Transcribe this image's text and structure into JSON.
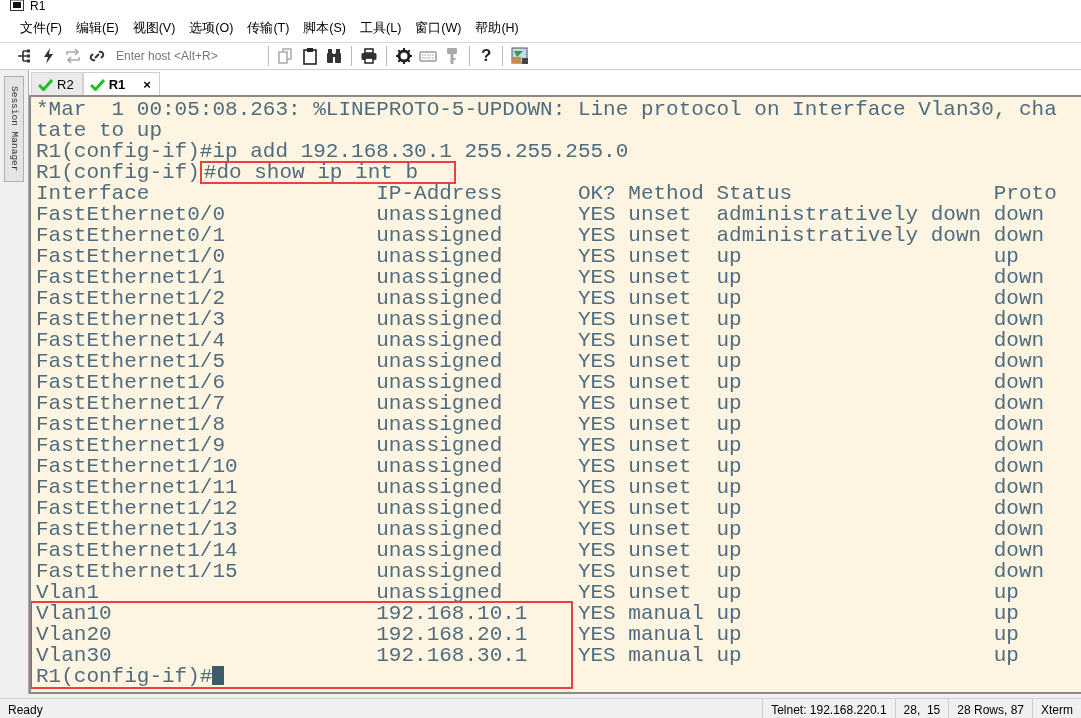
{
  "window": {
    "title": "R1"
  },
  "menu": [
    "文件(F)",
    "编辑(E)",
    "视图(V)",
    "选项(O)",
    "传输(T)",
    "脚本(S)",
    "工具(L)",
    "窗口(W)",
    "帮助(H)"
  ],
  "toolbar": {
    "host_field": {
      "placeholder": "Enter host <Alt+R>"
    },
    "help_glyph": "?"
  },
  "session_manager": {
    "label": "Session Manager"
  },
  "tabs": [
    {
      "label": "R2",
      "selected": false,
      "connected": true
    },
    {
      "label": "R1",
      "selected": true,
      "connected": true,
      "close": "×"
    }
  ],
  "terminal": {
    "lines": [
      {
        "kind": "text",
        "text": "*Mar  1 00:05:08.263: %LINEPROTO-5-UPDOWN: Line protocol on Interface Vlan30, cha",
        "boxed": false
      },
      {
        "kind": "text",
        "text": "tate to up",
        "boxed": false
      },
      {
        "kind": "text",
        "text": "R1(config-if)#ip add 192.168.30.1 255.255.255.0",
        "boxed": false
      },
      {
        "kind": "command",
        "prompt": "R1(config-if)",
        "command": "#do show ip int b",
        "boxed": true
      },
      {
        "kind": "header",
        "cells": [
          "Interface",
          "IP-Address",
          "OK?",
          "Method",
          "Status",
          "Proto"
        ],
        "boxed": false
      },
      {
        "kind": "row",
        "cells": [
          "FastEthernet0/0",
          "unassigned",
          "YES",
          "unset",
          "administratively down",
          "down"
        ],
        "boxed": false
      },
      {
        "kind": "row",
        "cells": [
          "FastEthernet0/1",
          "unassigned",
          "YES",
          "unset",
          "administratively down",
          "down"
        ],
        "boxed": false
      },
      {
        "kind": "row",
        "cells": [
          "FastEthernet1/0",
          "unassigned",
          "YES",
          "unset",
          "up",
          "up"
        ],
        "boxed": false
      },
      {
        "kind": "row",
        "cells": [
          "FastEthernet1/1",
          "unassigned",
          "YES",
          "unset",
          "up",
          "down"
        ],
        "boxed": false
      },
      {
        "kind": "row",
        "cells": [
          "FastEthernet1/2",
          "unassigned",
          "YES",
          "unset",
          "up",
          "down"
        ],
        "boxed": false
      },
      {
        "kind": "row",
        "cells": [
          "FastEthernet1/3",
          "unassigned",
          "YES",
          "unset",
          "up",
          "down"
        ],
        "boxed": false
      },
      {
        "kind": "row",
        "cells": [
          "FastEthernet1/4",
          "unassigned",
          "YES",
          "unset",
          "up",
          "down"
        ],
        "boxed": false
      },
      {
        "kind": "row",
        "cells": [
          "FastEthernet1/5",
          "unassigned",
          "YES",
          "unset",
          "up",
          "down"
        ],
        "boxed": false
      },
      {
        "kind": "row",
        "cells": [
          "FastEthernet1/6",
          "unassigned",
          "YES",
          "unset",
          "up",
          "down"
        ],
        "boxed": false
      },
      {
        "kind": "row",
        "cells": [
          "FastEthernet1/7",
          "unassigned",
          "YES",
          "unset",
          "up",
          "down"
        ],
        "boxed": false
      },
      {
        "kind": "row",
        "cells": [
          "FastEthernet1/8",
          "unassigned",
          "YES",
          "unset",
          "up",
          "down"
        ],
        "boxed": false
      },
      {
        "kind": "row",
        "cells": [
          "FastEthernet1/9",
          "unassigned",
          "YES",
          "unset",
          "up",
          "down"
        ],
        "boxed": false
      },
      {
        "kind": "row",
        "cells": [
          "FastEthernet1/10",
          "unassigned",
          "YES",
          "unset",
          "up",
          "down"
        ],
        "boxed": false
      },
      {
        "kind": "row",
        "cells": [
          "FastEthernet1/11",
          "unassigned",
          "YES",
          "unset",
          "up",
          "down"
        ],
        "boxed": false
      },
      {
        "kind": "row",
        "cells": [
          "FastEthernet1/12",
          "unassigned",
          "YES",
          "unset",
          "up",
          "down"
        ],
        "boxed": false
      },
      {
        "kind": "row",
        "cells": [
          "FastEthernet1/13",
          "unassigned",
          "YES",
          "unset",
          "up",
          "down"
        ],
        "boxed": false
      },
      {
        "kind": "row",
        "cells": [
          "FastEthernet1/14",
          "unassigned",
          "YES",
          "unset",
          "up",
          "down"
        ],
        "boxed": false
      },
      {
        "kind": "row",
        "cells": [
          "FastEthernet1/15",
          "unassigned",
          "YES",
          "unset",
          "up",
          "down"
        ],
        "boxed": false
      },
      {
        "kind": "row",
        "cells": [
          "Vlan1",
          "unassigned",
          "YES",
          "unset",
          "up",
          "up"
        ],
        "boxed": false
      },
      {
        "kind": "row",
        "cells": [
          "Vlan10",
          "192.168.10.1",
          "YES",
          "manual",
          "up",
          "up"
        ],
        "boxed": true
      },
      {
        "kind": "row",
        "cells": [
          "Vlan20",
          "192.168.20.1",
          "YES",
          "manual",
          "up",
          "up"
        ],
        "boxed": true
      },
      {
        "kind": "row",
        "cells": [
          "Vlan30",
          "192.168.30.1",
          "YES",
          "manual",
          "up",
          "up"
        ],
        "boxed": true
      },
      {
        "kind": "prompt",
        "text": "R1(config-if)#",
        "cursor": true,
        "boxed": true
      }
    ]
  },
  "status_bar": {
    "left": "Ready",
    "segments": [
      "Telnet: 192.168.220.1",
      "28,  15",
      "28 Rows, 87",
      "Xterm"
    ]
  }
}
